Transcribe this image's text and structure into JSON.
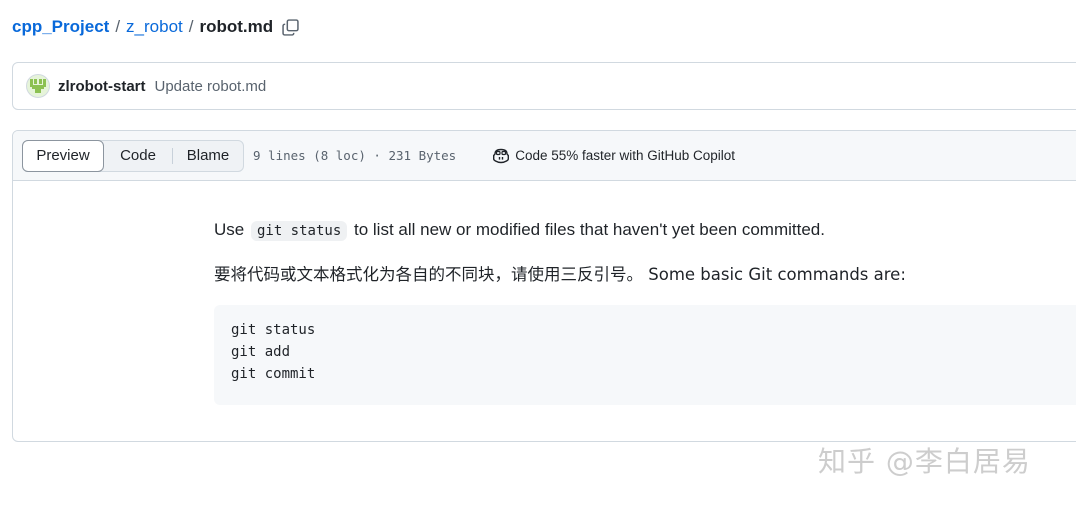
{
  "breadcrumb": {
    "repo": "cpp_Project",
    "sep1": "/",
    "folder": "z_robot",
    "sep2": "/",
    "file": "robot.md"
  },
  "commit": {
    "author": "zlrobot-start",
    "message": "Update robot.md"
  },
  "file_header": {
    "tabs": [
      {
        "label": "Preview",
        "active": true
      },
      {
        "label": "Code",
        "active": false
      },
      {
        "label": "Blame",
        "active": false
      }
    ],
    "meta": "9 lines (8 loc) · 231 Bytes",
    "copilot": "Code 55% faster with GitHub Copilot"
  },
  "content": {
    "p1_before": "Use",
    "p1_code": "git status",
    "p1_after": "to list all new or modified files that haven't yet been committed.",
    "p2": "要将代码或文本格式化为各自的不同块，请使用三反引号。 Some basic Git commands are:",
    "code_lines": [
      "git status",
      "git add",
      "git commit"
    ]
  },
  "watermark": "知乎 @李白居易",
  "icons": {
    "copy": "copy-icon",
    "avatar": "identicon-avatar",
    "copilot": "copilot-icon"
  }
}
